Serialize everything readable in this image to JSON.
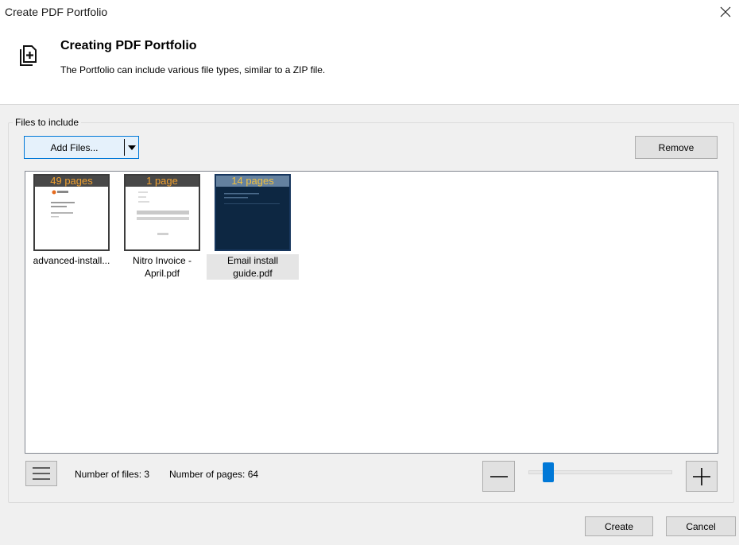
{
  "window": {
    "title": "Create PDF Portfolio",
    "close_icon": "close-icon"
  },
  "header": {
    "icon": "portfolio-add-icon",
    "heading": "Creating PDF Portfolio",
    "description": "The Portfolio can include various file types, similar to a ZIP file."
  },
  "files_group": {
    "label": "Files to include",
    "add_files_label": "Add Files...",
    "remove_label": "Remove",
    "files": [
      {
        "page_badge": "49 pages",
        "name": "advanced-install...",
        "selected": false
      },
      {
        "page_badge": "1 page",
        "name": "Nitro Invoice - April.pdf",
        "selected": false
      },
      {
        "page_badge": "14 pages",
        "name": "Email install guide.pdf",
        "selected": true
      }
    ]
  },
  "status": {
    "files_text": "Number of files: 3",
    "pages_text": "Number of pages: 64"
  },
  "zoom": {
    "minus_icon": "minus-icon",
    "plus_icon": "plus-icon",
    "level_fraction": 0.1
  },
  "footer": {
    "create_label": "Create",
    "cancel_label": "Cancel"
  },
  "colors": {
    "accent": "#0078d7",
    "badge_text": "#f0a030",
    "selected_thumb": "#0d2742"
  }
}
